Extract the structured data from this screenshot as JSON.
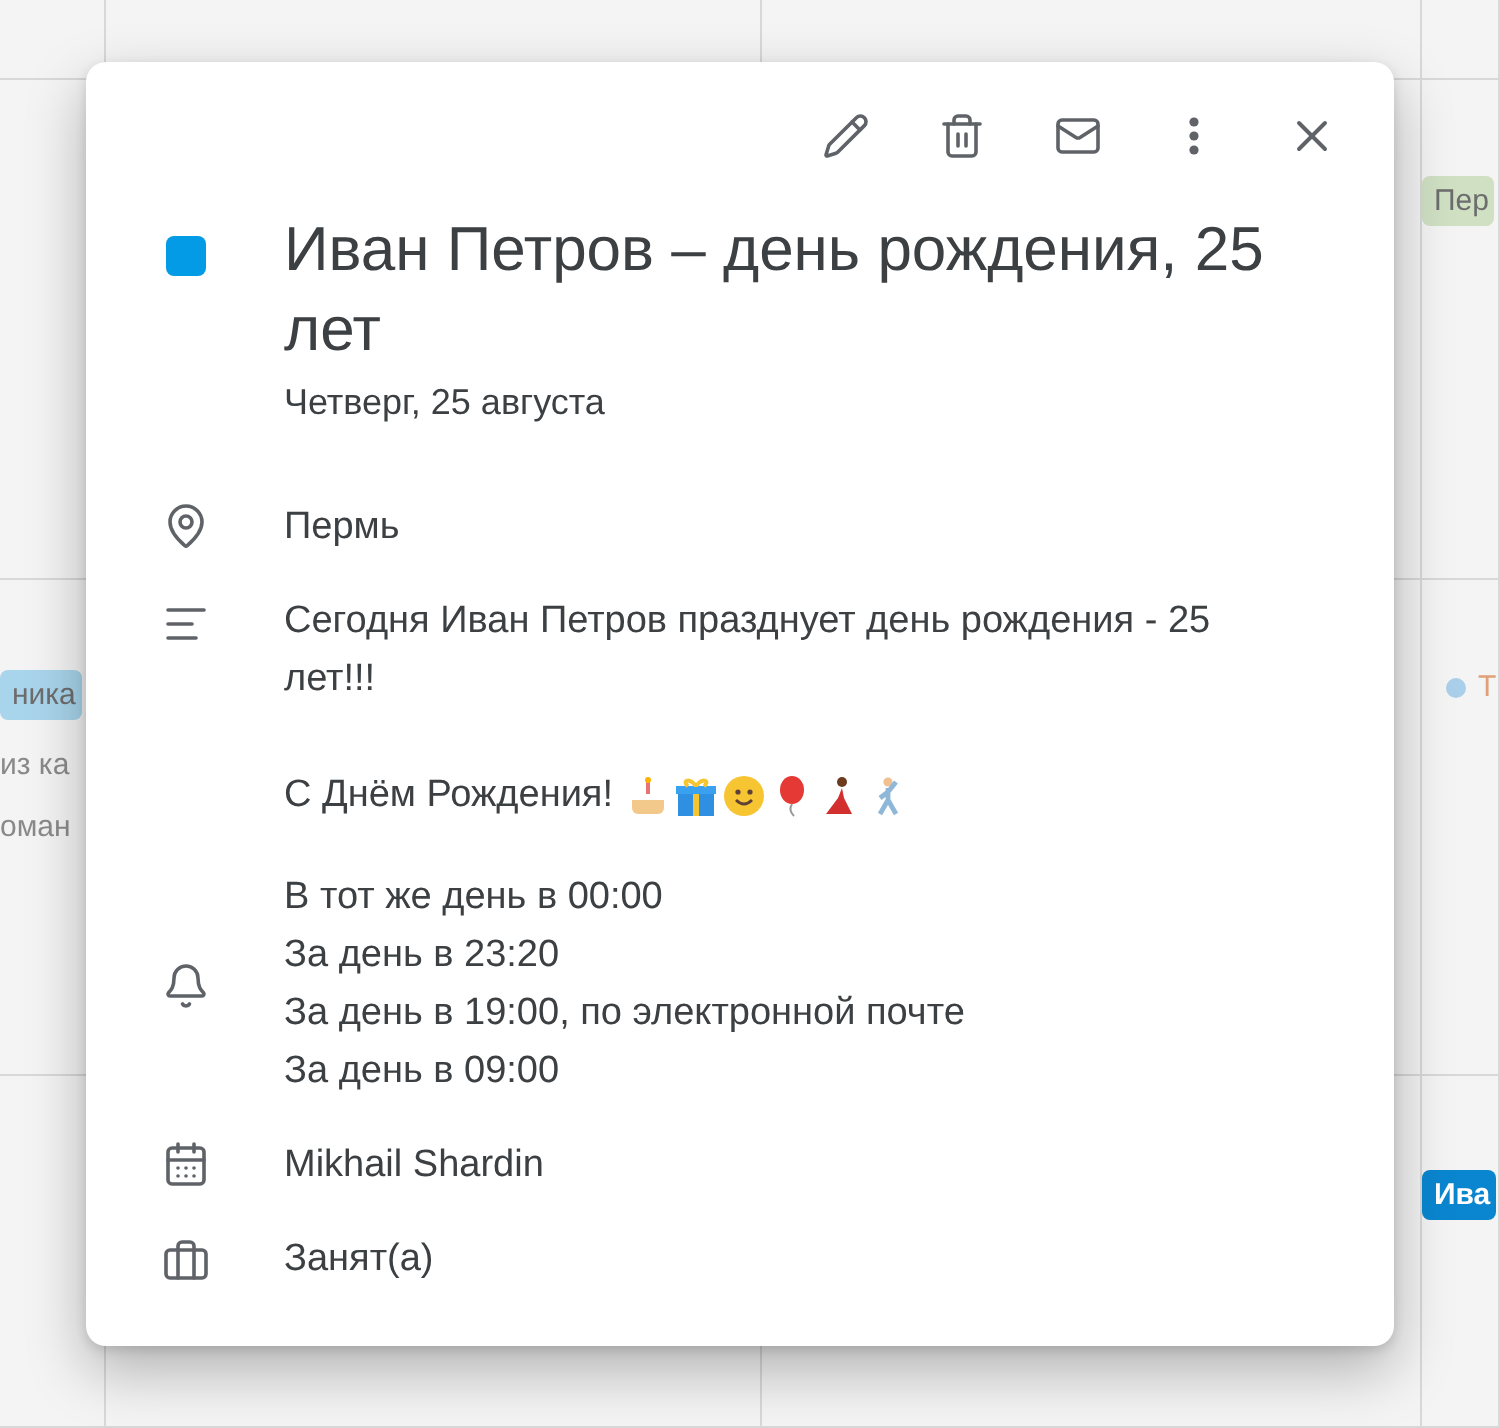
{
  "background": {
    "chips": [
      {
        "kind": "chip",
        "text": "Пер",
        "color": "#cfe0c3"
      },
      {
        "kind": "chip",
        "text": "ника",
        "color": "#a9d5ec"
      },
      {
        "kind": "dot",
        "text": "Т",
        "color": "#a9cfea"
      },
      {
        "kind": "text",
        "text": "из ка"
      },
      {
        "kind": "text",
        "text": "оман"
      },
      {
        "kind": "chip",
        "text": "Ива",
        "color": "#0a86d0"
      }
    ]
  },
  "event": {
    "color": "#039be5",
    "title": "Иван Петров – день рождения, 25 лет",
    "date": "Четверг, 25 августа",
    "details": [
      {
        "kind": "location",
        "lines": [
          "Пермь"
        ]
      },
      {
        "kind": "description",
        "lines": [
          "Сегодня Иван Петров празднует день рождения - 25 лет!!!",
          "С Днём Рождения!"
        ]
      },
      {
        "kind": "reminders",
        "lines": [
          "В тот же день в 00:00",
          "За день в 23:20",
          "За день в 19:00, по электронной почте",
          "За день в 09:00"
        ]
      },
      {
        "kind": "calendar",
        "lines": [
          "Mikhail Shardin"
        ]
      },
      {
        "kind": "availability",
        "lines": [
          "Занят(а)"
        ]
      }
    ]
  }
}
